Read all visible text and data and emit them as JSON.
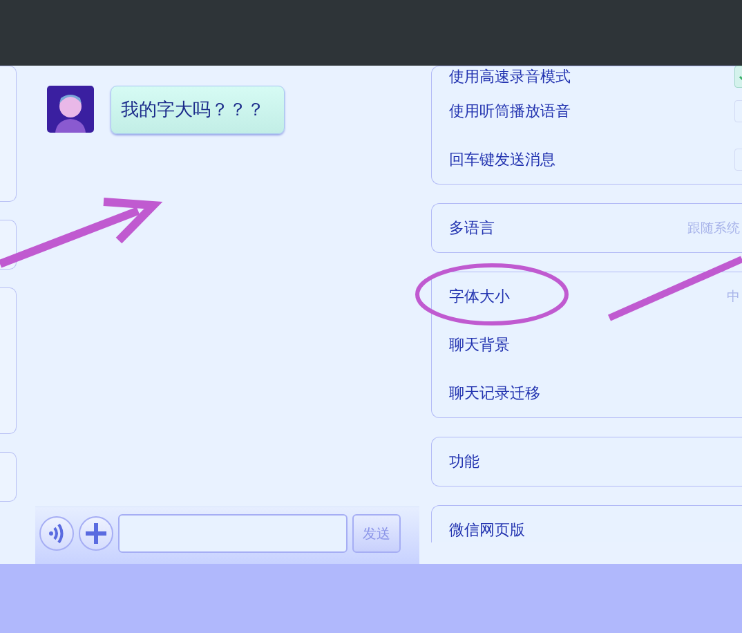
{
  "chat": {
    "messages": [
      {
        "text": "我的字大吗？？？"
      }
    ],
    "composer": {
      "send": "发送"
    }
  },
  "settings": {
    "groups": [
      {
        "items": [
          {
            "kind": "toggle",
            "label": "使用高速录音模式",
            "checked": true
          },
          {
            "kind": "toggle",
            "label": "使用听筒播放语音",
            "checked": false
          },
          {
            "kind": "toggle",
            "label": "回车键发送消息",
            "checked": false
          }
        ]
      },
      {
        "items": [
          {
            "kind": "link",
            "label": "多语言",
            "value": "跟随系统"
          }
        ]
      },
      {
        "items": [
          {
            "kind": "link",
            "label": "字体大小",
            "value": "中"
          },
          {
            "kind": "link",
            "label": "聊天背景"
          },
          {
            "kind": "link",
            "label": "聊天记录迁移"
          }
        ]
      },
      {
        "items": [
          {
            "kind": "link",
            "label": "功能"
          }
        ]
      },
      {
        "items": [
          {
            "kind": "link",
            "label": "微信网页版"
          }
        ]
      }
    ]
  }
}
